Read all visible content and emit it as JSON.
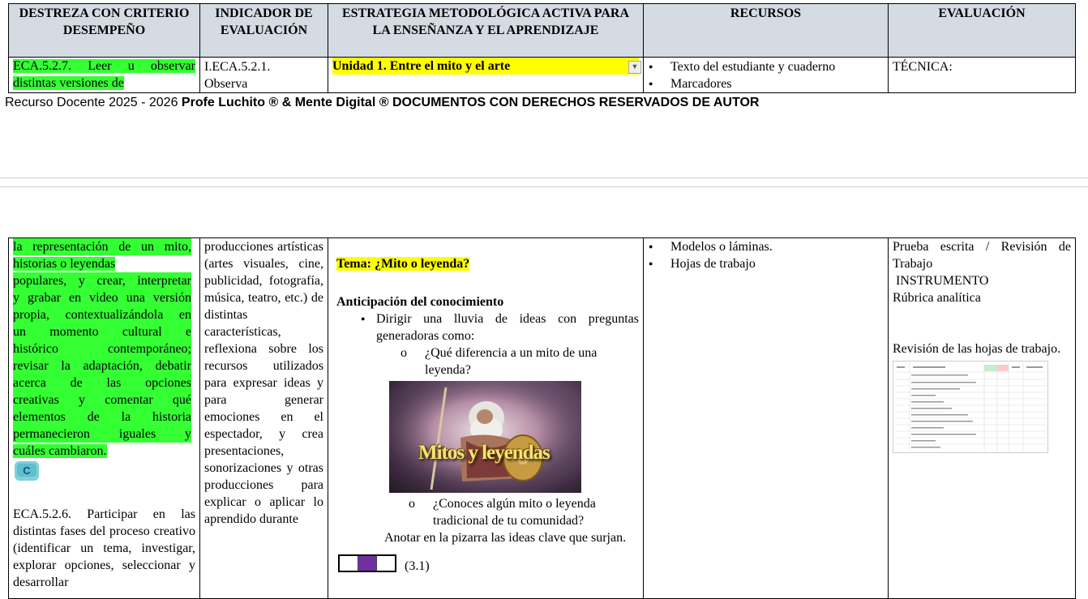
{
  "header": {
    "col1": "DESTREZA CON CRITERIO DESEMPEÑO",
    "col2": "INDICADOR DE EVALUACIÓN",
    "col3": "ESTRATEGIA METODOLÓGICA ACTIVA PARA LA ENSEÑANZA Y EL APRENDIZAJE",
    "col4": "RECURSOS",
    "col5": "EVALUACIÓN"
  },
  "row1": {
    "destreza": "ECA.5.2.7. Leer u observar distintas versiones de",
    "indicador_a": "I.ECA.5.2.1.",
    "indicador_b": "Observa",
    "unidad": "Unidad 1. Entre el mito y el arte",
    "recursos": [
      "Texto del estudiante y cuaderno",
      "Marcadores"
    ],
    "evaluacion": "TÉCNICA:"
  },
  "footer": {
    "prefix": "Recurso Docente 2025 - 2026 ",
    "bold": "Profe Luchito ® & Mente Digital ® DOCUMENTOS CON DERECHOS RESERVADOS DE AUTOR"
  },
  "row2": {
    "destreza_hl_lines": [
      "la representación de un mito,",
      "historias o leyendas",
      "populares, y crear, interpretar",
      "y grabar en video una versión",
      "propia, contextualizándola en",
      "un momento cultural e",
      "histórico contemporáneo;",
      "revisar la adaptación, debatir",
      "acerca de las opciones",
      "creativas y comentar qué",
      "elementos de la historia",
      "permanecieron iguales y",
      "cuáles cambiaron."
    ],
    "destreza_2": "ECA.5.2.6. Participar en las distintas fases del proceso creativo (identificar un tema, investigar, explorar opciones, seleccionar y desarrollar",
    "indicador": "producciones artísticas (artes visuales, cine, publicidad, fotografía, música, teatro, etc.) de distintas características, reflexiona sobre los recursos utilizados para expresar ideas y para generar emociones en el espectador, y crea presentaciones, sonorizaciones y otras producciones para explicar o aplicar lo aprendido durante",
    "tema": "Tema: ¿Mito o leyenda?",
    "anticipacion": "Anticipación del conocimiento",
    "bullet1": "Dirigir una lluvia de ideas con preguntas generadoras como:",
    "q1": "¿Qué diferencia a un mito de una leyenda?",
    "image_caption": "Mitos y leyendas",
    "q2": "¿Conoces algún mito o leyenda tradicional de tu comunidad?",
    "anotar": "Anotar en la pizarra las ideas clave que surjan.",
    "code": "(3.1)",
    "recursos": [
      "Modelos o láminas.",
      "Hojas de trabajo"
    ],
    "eval1": "Prueba escrita / Revisión de Trabajo",
    "eval2": "INSTRUMENTO",
    "eval3": "Rúbrica analítica",
    "eval4": "Revisión de las hojas de trabajo."
  },
  "colors": {
    "header_bg": "#d5dbe3",
    "green_highlight": "#33ff33",
    "yellow_highlight": "#ffff00",
    "purple": "#7030a0"
  }
}
